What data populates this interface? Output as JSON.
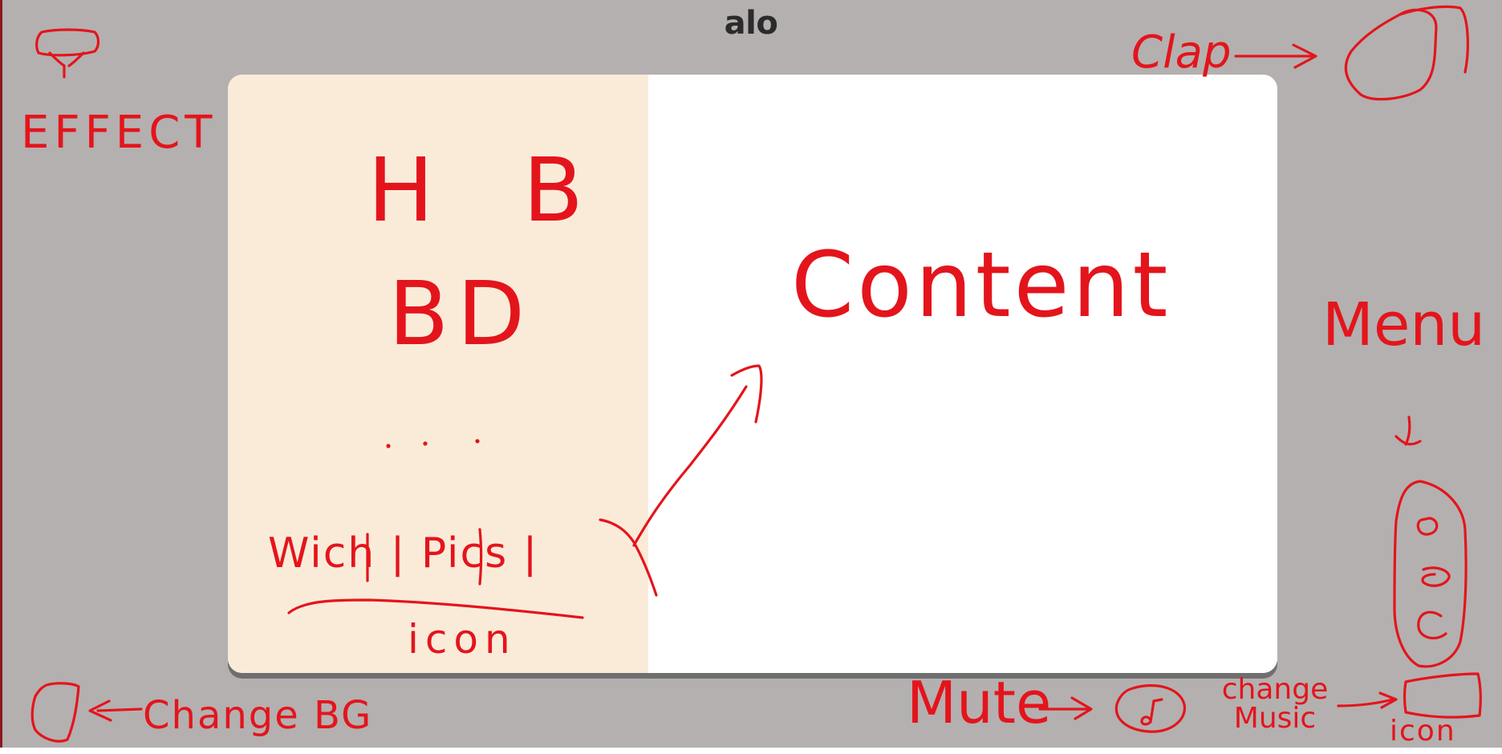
{
  "window": {
    "title": "alo"
  },
  "annotations": {
    "effect": "EFFECT",
    "clap": "Clap",
    "hb": "H B",
    "bd": "BD",
    "dots": ". . .",
    "content": "Content",
    "menu": "Menu",
    "wich_pics": "Wich | Pics |",
    "icon": "icon",
    "change_bg": "Change BG",
    "mute": "Mute",
    "change_music": "change Music",
    "icon_bottom": "icon"
  },
  "colors": {
    "background": "#b4b0af",
    "card_left_panel": "#faebd9",
    "card_right_panel": "#ffffff",
    "annotation_ink": "#e4141c",
    "title_text": "#2b2b2b"
  },
  "icons": [
    "effect-lamp-icon",
    "clap-circle-icon",
    "music-note-icon",
    "change-music-box-icon",
    "change-bg-box-icon",
    "menu-options-icon"
  ]
}
